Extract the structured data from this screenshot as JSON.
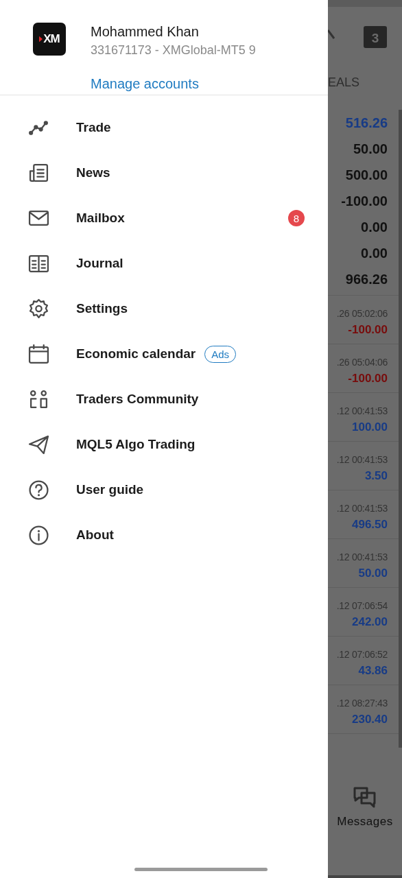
{
  "drawer": {
    "logo": "XM",
    "name": "Mohammed Khan",
    "account": "331671173 - XMGlobal-MT5 9",
    "manage": "Manage accounts",
    "items": [
      {
        "kind": "trade",
        "label": "Trade"
      },
      {
        "kind": "news",
        "label": "News"
      },
      {
        "kind": "mail",
        "label": "Mailbox",
        "badge": "8"
      },
      {
        "kind": "journal",
        "label": "Journal"
      },
      {
        "kind": "settings",
        "label": "Settings"
      },
      {
        "kind": "calendar",
        "label": "Economic calendar",
        "tag": "Ads"
      },
      {
        "kind": "community",
        "label": "Traders Community"
      },
      {
        "kind": "send",
        "label": "MQL5 Algo Trading"
      },
      {
        "kind": "help",
        "label": "User guide"
      },
      {
        "kind": "info",
        "label": "About"
      }
    ]
  },
  "background": {
    "calendar_day": "3",
    "tab": "EALS",
    "summary": [
      {
        "value": "516.26",
        "color": "#173b86"
      },
      {
        "value": "50.00",
        "color": "#111111"
      },
      {
        "value": "500.00",
        "color": "#111111"
      },
      {
        "value": "-100.00",
        "color": "#111111"
      },
      {
        "value": "0.00",
        "color": "#111111"
      },
      {
        "value": "0.00",
        "color": "#111111"
      },
      {
        "value": "966.26",
        "color": "#111111"
      }
    ],
    "deals": [
      {
        "time": ".26 05:02:06",
        "amount": "-100.00",
        "color": "#780c0c"
      },
      {
        "time": ".26 05:04:06",
        "amount": "-100.00",
        "color": "#780c0c"
      },
      {
        "time": ".12 00:41:53",
        "amount": "100.00",
        "color": "#173b86"
      },
      {
        "time": ".12 00:41:53",
        "amount": "3.50",
        "color": "#173b86"
      },
      {
        "time": ".12 00:41:53",
        "amount": "496.50",
        "color": "#173b86"
      },
      {
        "time": ".12 00:41:53",
        "amount": "50.00",
        "color": "#173b86"
      },
      {
        "time": ".12 07:06:54",
        "amount": "242.00",
        "color": "#173b86"
      },
      {
        "time": ".12 07:06:52",
        "amount": "43.86",
        "color": "#173b86"
      },
      {
        "time": ".12 08:27:43",
        "amount": "230.40",
        "color": "#173b86"
      }
    ],
    "bottom_tab": "Messages"
  }
}
